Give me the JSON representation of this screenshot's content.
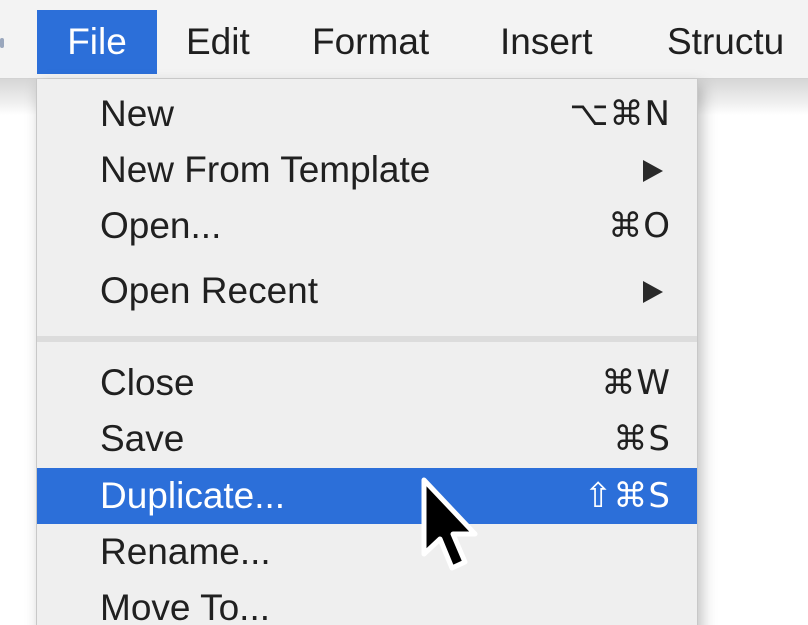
{
  "menubar": {
    "items": [
      {
        "label": "File",
        "active": true
      },
      {
        "label": "Edit"
      },
      {
        "label": "Format"
      },
      {
        "label": "Insert"
      },
      {
        "label": "Structu"
      }
    ]
  },
  "file_menu": {
    "items": [
      {
        "label": "New",
        "shortcut": "⌥⌘N"
      },
      {
        "label": "New From Template",
        "submenu": true
      },
      {
        "label": "Open...",
        "shortcut": "⌘O"
      },
      {
        "label": "Open Recent",
        "submenu": true
      },
      {
        "label": "Close",
        "shortcut": "⌘W"
      },
      {
        "label": "Save",
        "shortcut": "⌘S"
      },
      {
        "label": "Duplicate...",
        "shortcut": "⇧⌘S",
        "highlighted": true
      },
      {
        "label": "Rename..."
      },
      {
        "label": "Move To..."
      }
    ]
  },
  "colors": {
    "accent": "#2c6fd9",
    "menu_background": "#efefef",
    "menubar_background": "#f3f3f3",
    "text": "#202020"
  },
  "icons": {
    "submenu": "triangle-right-icon",
    "cursor": "mouse-pointer-icon"
  }
}
